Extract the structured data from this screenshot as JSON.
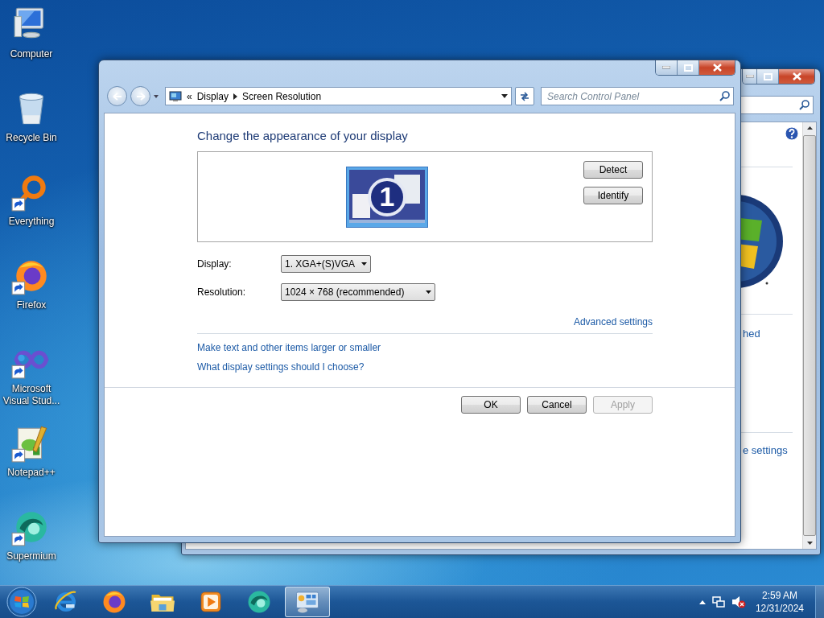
{
  "desktop_icons": [
    {
      "label": "Computer",
      "kind": "computer",
      "shortcut": false
    },
    {
      "label": "Recycle Bin",
      "kind": "recycle-bin",
      "shortcut": false
    },
    {
      "label": "Everything",
      "kind": "everything",
      "shortcut": true
    },
    {
      "label": "Firefox",
      "kind": "firefox",
      "shortcut": true
    },
    {
      "label": "Microsoft Visual Stud...",
      "kind": "visual-studio",
      "shortcut": true
    },
    {
      "label": "Notepad++",
      "kind": "notepad",
      "shortcut": true
    },
    {
      "label": "Supermium",
      "kind": "supermium",
      "shortcut": true
    }
  ],
  "back_window": {
    "texts": [
      "hed",
      "e settings"
    ]
  },
  "window": {
    "address": {
      "prefix": "«",
      "path": [
        "Display",
        "Screen Resolution"
      ]
    },
    "search": {
      "placeholder": "Search Control Panel"
    },
    "heading": "Change the appearance of your display",
    "monitor": {
      "number": "1"
    },
    "preview_buttons": [
      "Detect",
      "Identify"
    ],
    "fields": [
      {
        "label": "Display:",
        "value": "1. XGA+(S)VGA"
      },
      {
        "label": "Resolution:",
        "value": "1024 × 768 (recommended)"
      }
    ],
    "advanced_link": "Advanced settings",
    "links": [
      "Make text and other items larger or smaller",
      "What display settings should I choose?"
    ],
    "buttons": [
      {
        "label": "OK",
        "disabled": false
      },
      {
        "label": "Cancel",
        "disabled": false
      },
      {
        "label": "Apply",
        "disabled": true
      }
    ]
  },
  "taskbar": {
    "items": [
      {
        "kind": "internet-explorer",
        "selected": false
      },
      {
        "kind": "firefox",
        "selected": false
      },
      {
        "kind": "folder",
        "selected": false
      },
      {
        "kind": "media",
        "selected": false
      },
      {
        "kind": "supermium",
        "selected": false
      },
      {
        "kind": "control-panel",
        "selected": true
      }
    ],
    "clock": {
      "time": "2:59 AM",
      "date": "12/31/2024"
    }
  }
}
